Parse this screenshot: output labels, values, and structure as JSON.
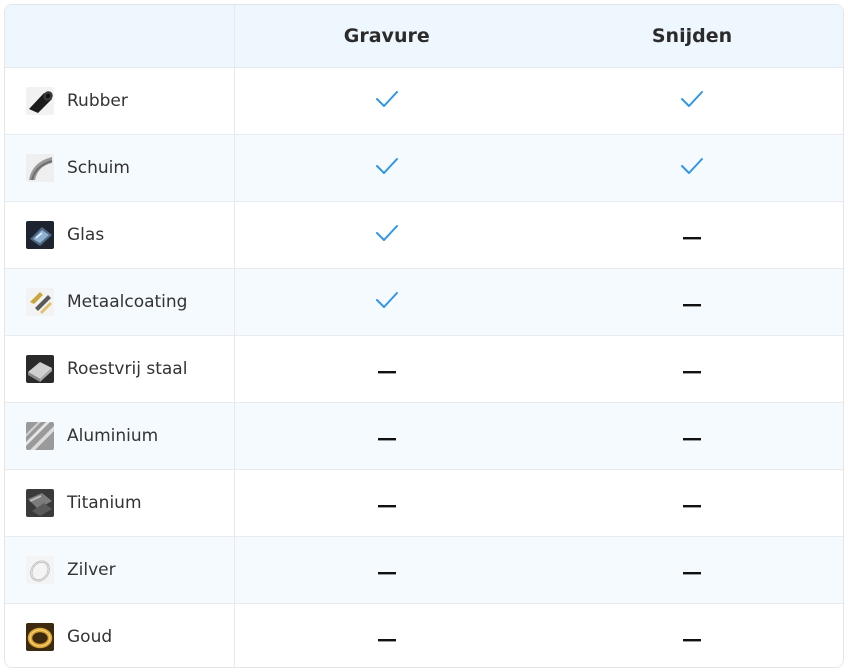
{
  "header": {
    "col_gravure": "Gravure",
    "col_snijden": "Snijden"
  },
  "colors": {
    "check": "#2f96e8",
    "dash": "#111111",
    "header_bg": "#eef7fe",
    "stripe_bg": "#f5faff"
  },
  "rows": [
    {
      "material": "Rubber",
      "icon": "rubber-roll-icon",
      "gravure": "check",
      "snijden": "check"
    },
    {
      "material": "Schuim",
      "icon": "foam-icon",
      "gravure": "check",
      "snijden": "check"
    },
    {
      "material": "Glas",
      "icon": "glass-icon",
      "gravure": "check",
      "snijden": "dash"
    },
    {
      "material": "Metaalcoating",
      "icon": "metal-coating-icon",
      "gravure": "check",
      "snijden": "dash"
    },
    {
      "material": "Roestvrij staal",
      "icon": "stainless-steel-icon",
      "gravure": "dash",
      "snijden": "dash"
    },
    {
      "material": "Aluminium",
      "icon": "aluminium-icon",
      "gravure": "dash",
      "snijden": "dash"
    },
    {
      "material": "Titanium",
      "icon": "titanium-icon",
      "gravure": "dash",
      "snijden": "dash"
    },
    {
      "material": "Zilver",
      "icon": "silver-ring-icon",
      "gravure": "dash",
      "snijden": "dash"
    },
    {
      "material": "Goud",
      "icon": "gold-ring-icon",
      "gravure": "dash",
      "snijden": "dash"
    }
  ]
}
